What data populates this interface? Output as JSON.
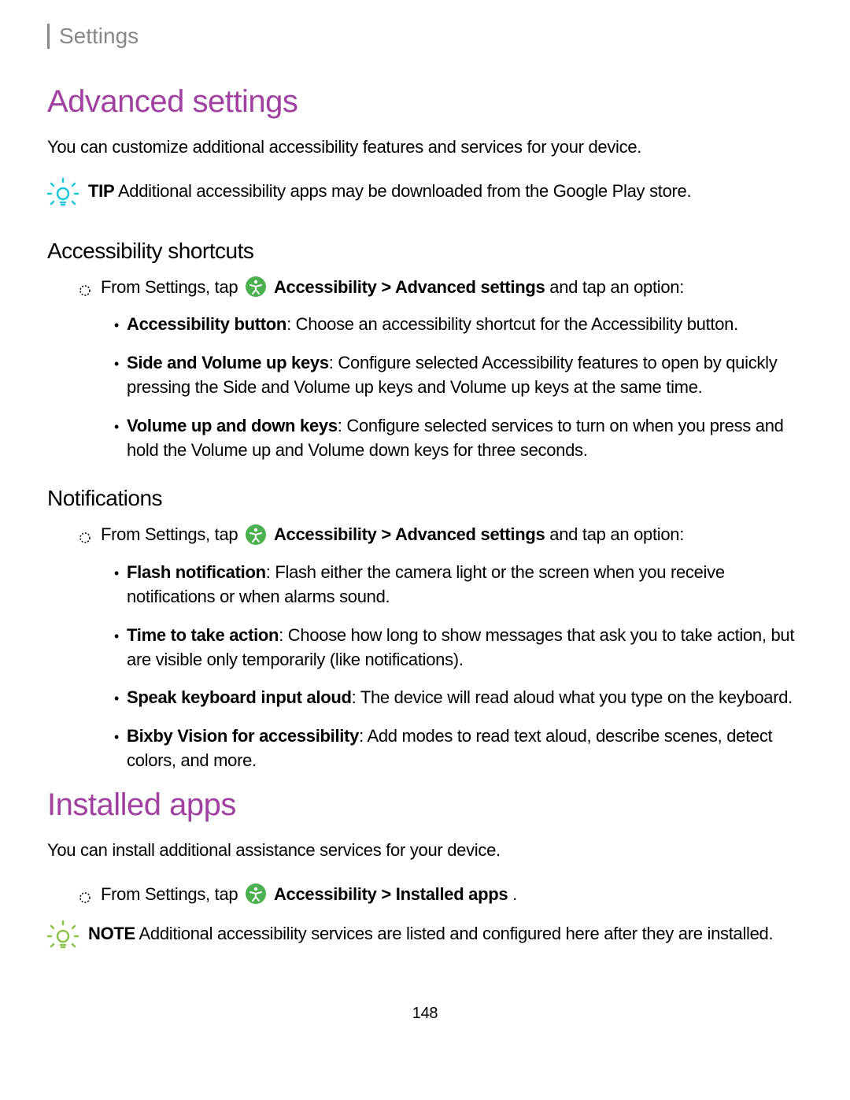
{
  "breadcrumb": "Settings",
  "section1": {
    "title": "Advanced settings",
    "intro": "You can customize additional accessibility features and services for your device.",
    "tip_label": "TIP",
    "tip_text": "Additional accessibility apps may be downloaded from the Google Play store.",
    "sub1": {
      "title": "Accessibility shortcuts",
      "step_prefix": "From Settings, tap ",
      "step_path1": "Accessibility",
      "step_sep": " > ",
      "step_path2": "Advanced settings",
      "step_suffix": " and tap an option:",
      "items": [
        {
          "bold": "Accessibility button",
          "text": ": Choose an accessibility shortcut for the Accessibility button."
        },
        {
          "bold": "Side and Volume up keys",
          "text": ": Configure selected Accessibility features to open by quickly pressing the Side and Volume up keys and Volume up keys at the same time."
        },
        {
          "bold": "Volume up and down keys",
          "text": ": Configure selected services to turn on when you press and hold the Volume up and Volume down keys for three seconds."
        }
      ]
    },
    "sub2": {
      "title": "Notifications",
      "step_prefix": "From Settings, tap ",
      "step_path1": "Accessibility",
      "step_sep": " > ",
      "step_path2": "Advanced settings",
      "step_suffix": " and tap an option:",
      "items": [
        {
          "bold": "Flash notification",
          "text": ": Flash either the camera light or the screen when you receive notifications or when alarms sound."
        },
        {
          "bold": "Time to take action",
          "text": ": Choose how long to show messages that ask you to take action, but are visible only temporarily (like notifications)."
        },
        {
          "bold": "Speak keyboard input aloud",
          "text": ": The device will read aloud what you type on the keyboard."
        },
        {
          "bold": "Bixby Vision for accessibility",
          "text": ": Add modes to read text aloud, describe scenes, detect colors, and more."
        }
      ]
    }
  },
  "section2": {
    "title": "Installed apps",
    "intro": "You can install additional assistance services for your device.",
    "step_prefix": "From Settings, tap ",
    "step_path1": "Accessibility",
    "step_sep": " > ",
    "step_path2": "Installed apps",
    "step_suffix": ".",
    "note_label": "NOTE",
    "note_text": "Additional accessibility services are listed and configured here after they are installed."
  },
  "page_number": "148"
}
